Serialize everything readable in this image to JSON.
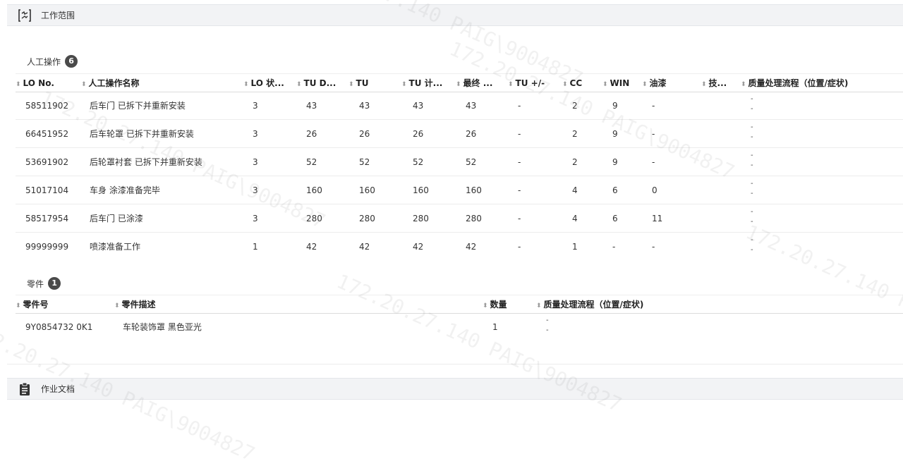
{
  "work_scope": {
    "title": "工作范围",
    "icon": "wrench-tool-icon"
  },
  "labor": {
    "title": "人工操作",
    "count": "6",
    "columns": [
      "LO No.",
      "人工操作名称",
      "LO 状...",
      "TU D...",
      "TU",
      "TU 计...",
      "最终 ...",
      "TU +/-",
      "CC",
      "WIN",
      "油漆",
      "技...",
      "质量处理流程（位置/症状)"
    ],
    "rows": [
      [
        "58511902",
        "后车门 已拆下并重新安装",
        "3",
        "43",
        "43",
        "43",
        "43",
        "-",
        "2",
        "9",
        "-",
        "",
        "-",
        "-"
      ],
      [
        "66451952",
        "后车轮罩 已拆下并重新安装",
        "3",
        "26",
        "26",
        "26",
        "26",
        "-",
        "2",
        "9",
        "-",
        "",
        "-",
        "-"
      ],
      [
        "53691902",
        "后轮罩衬套 已拆下并重新安装",
        "3",
        "52",
        "52",
        "52",
        "52",
        "-",
        "2",
        "9",
        "-",
        "",
        "-",
        "-"
      ],
      [
        "51017104",
        "车身 涂漆准备完毕",
        "3",
        "160",
        "160",
        "160",
        "160",
        "-",
        "4",
        "6",
        "0",
        "",
        "-",
        "-"
      ],
      [
        "58517954",
        "后车门 已涂漆",
        "3",
        "280",
        "280",
        "280",
        "280",
        "-",
        "4",
        "6",
        "11",
        "",
        "-",
        "-"
      ],
      [
        "99999999",
        "喷漆准备工作",
        "1",
        "42",
        "42",
        "42",
        "42",
        "-",
        "1",
        "-",
        "-",
        "",
        "-",
        "-"
      ]
    ]
  },
  "parts": {
    "title": "零件",
    "count": "1",
    "columns": [
      "零件号",
      "零件描述",
      "数量",
      "质量处理流程（位置/症状)"
    ],
    "rows": [
      [
        "9Y0854732 0K1",
        "车轮装饰罩 黑色亚光",
        "1",
        "-",
        "-"
      ]
    ]
  },
  "documents": {
    "title": "作业文档",
    "icon": "clipboard-icon"
  },
  "watermark": "172.20.27.140 PAIG\\9004827"
}
